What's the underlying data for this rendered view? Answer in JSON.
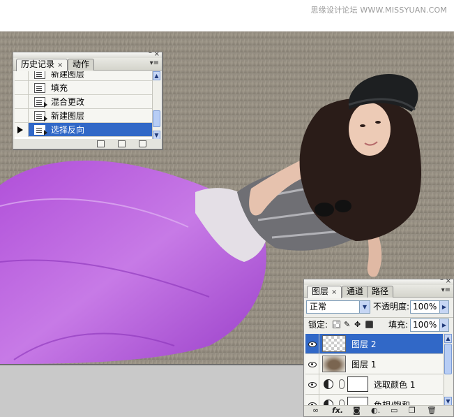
{
  "watermark": "思缘设计论坛 WWW.MISSYUAN.COM",
  "canvas": {
    "image": "woman-lying-in-grass-purple-skirt"
  },
  "history_panel": {
    "tabs": [
      {
        "label": "历史记录",
        "active": true
      },
      {
        "label": "动作",
        "active": false
      }
    ],
    "items": [
      {
        "label": "新建图层",
        "icon": "history-state-icon",
        "selected": false
      },
      {
        "label": "填充",
        "icon": "history-state-icon",
        "selected": false
      },
      {
        "label": "混合更改",
        "icon": "history-state-icon",
        "selected": false
      },
      {
        "label": "新建图层",
        "icon": "history-state-icon",
        "selected": false
      },
      {
        "label": "选择反向",
        "icon": "history-state-icon",
        "selected": true
      }
    ],
    "footer_icons": [
      "new-document-from-state-icon",
      "new-snapshot-icon",
      "delete-state-icon"
    ]
  },
  "layers_panel": {
    "tabs": [
      {
        "label": "图层",
        "active": true
      },
      {
        "label": "通道",
        "active": false
      },
      {
        "label": "路径",
        "active": false
      }
    ],
    "blend_mode": "正常",
    "opacity_label": "不透明度:",
    "opacity_value": "100%",
    "lock_label": "锁定:",
    "fill_label": "填充:",
    "fill_value": "100%",
    "layers": [
      {
        "name": "图层 2",
        "type": "pixel",
        "thumb": "transparent",
        "selected": true
      },
      {
        "name": "图层 1",
        "type": "pixel",
        "thumb": "brown-blur",
        "selected": false
      },
      {
        "name": "选取颜色 1",
        "type": "adjustment",
        "selected": false
      },
      {
        "name": "色相/饱和",
        "type": "adjustment",
        "selected": false
      }
    ],
    "footer_icons": [
      "link-layers-icon",
      "fx-icon",
      "add-mask-icon",
      "new-adjustment-icon",
      "new-group-icon",
      "new-layer-icon",
      "delete-layer-icon"
    ]
  }
}
